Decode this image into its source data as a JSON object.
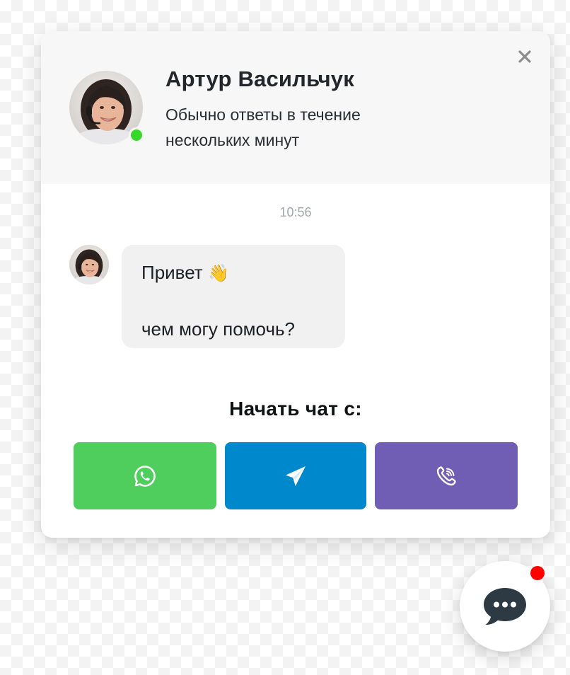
{
  "agent": {
    "name": "Артур Васильчук",
    "status_line_1": "Обычно ответы в течение",
    "status_line_2": "нескольких минут"
  },
  "chat": {
    "timestamp": "10:56",
    "message": {
      "line_1": "Привет",
      "emoji": "👋",
      "line_2": "чем могу помочь?"
    }
  },
  "start_chat": {
    "title": "Начать чат с:",
    "channels": [
      {
        "name": "WhatsApp",
        "icon": "whatsapp-icon",
        "color": "#4fce5d"
      },
      {
        "name": "Telegram",
        "icon": "telegram-icon",
        "color": "#0088cc"
      },
      {
        "name": "Viber",
        "icon": "viber-icon",
        "color": "#6f5eb4"
      }
    ]
  },
  "icons": {
    "close": "close-icon",
    "launcher": "chat-bubble-icon"
  },
  "colors": {
    "online_status": "#38d82a",
    "notification": "#ff0000",
    "launcher_icon": "#2d3a44",
    "header_bg": "#f7f7f7",
    "bubble_bg": "#f1f1f1"
  }
}
